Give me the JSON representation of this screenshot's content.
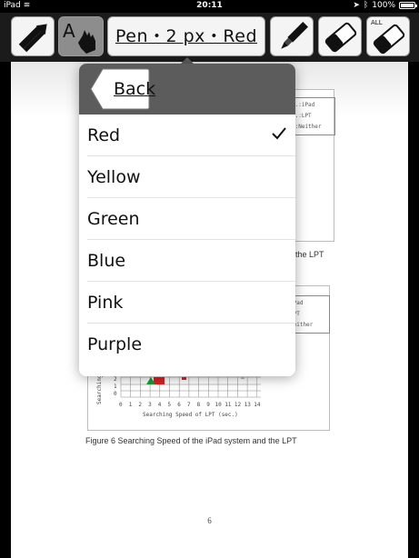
{
  "status_bar": {
    "device": "iPad",
    "time": "20:11",
    "battery": "100%"
  },
  "toolbar": {
    "pen_label": "Pen・2 px・Red",
    "all_label": "ALL",
    "text_tool_letter": "A"
  },
  "popover": {
    "back_label": "Back",
    "colors": [
      {
        "label": "Red",
        "selected": true
      },
      {
        "label": "Yellow",
        "selected": false
      },
      {
        "label": "Green",
        "selected": false
      },
      {
        "label": "Blue",
        "selected": false
      },
      {
        "label": "Pink",
        "selected": false
      },
      {
        "label": "Purple",
        "selected": false
      }
    ]
  },
  "document": {
    "fig1_legend": [
      "f.:iPad",
      "f.:LPT",
      "f:Neither"
    ],
    "fig1_caption_tail": "the LPT",
    "fig2_legend": [
      "iPad",
      "LPT",
      "Neither"
    ],
    "fig2_ylabel": "Searching",
    "fig2_xlabel": "Searching Speed of LPT (sec.)",
    "fig2_y_ticks": [
      "2",
      "1",
      "0"
    ],
    "fig2_x_ticks": [
      "0",
      "1",
      "2",
      "3",
      "4",
      "5",
      "6",
      "7",
      "8",
      "9",
      "10",
      "11",
      "12",
      "13",
      "14"
    ],
    "fig2_caption": "Figure 6    Searching Speed of the iPad system and the LPT",
    "page_number": "6"
  },
  "colors": {
    "toolbar_bg": "#1b1b1b",
    "popover_header": "#5c5c5c",
    "accent_red": "#e02020",
    "accent_green": "#1f9a3a"
  }
}
